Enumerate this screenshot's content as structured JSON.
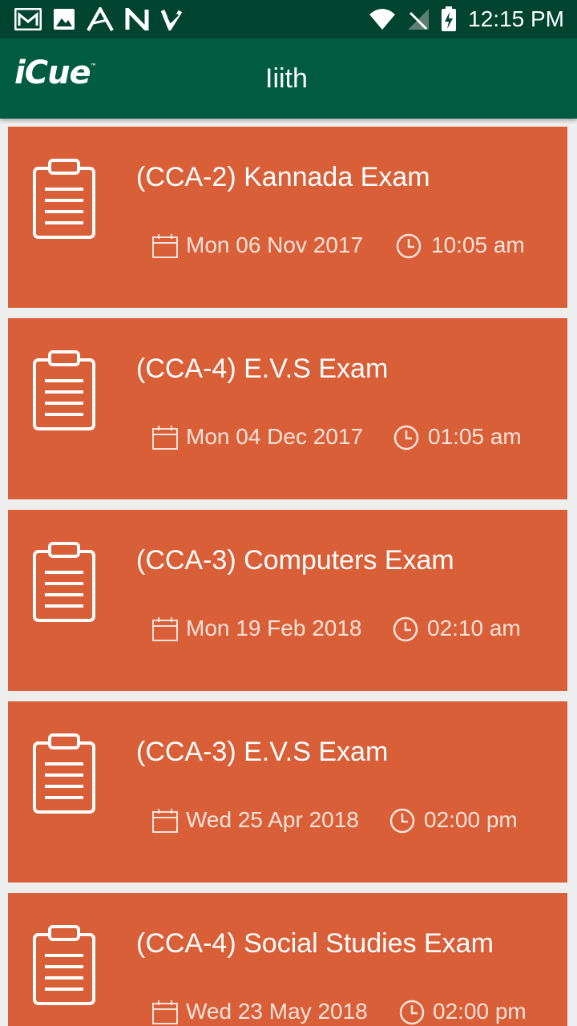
{
  "status_bar": {
    "time": "12:15 PM",
    "left_icons": [
      "gmail-icon",
      "image-icon",
      "app-a-icon",
      "app-n-icon",
      "check-icon"
    ],
    "right_icons": [
      "wifi-icon",
      "no-signal-icon",
      "battery-charging-icon"
    ]
  },
  "app_bar": {
    "logo": "iCue",
    "trademark": "™",
    "title": "Iiith",
    "color": "#005c40"
  },
  "exams": [
    {
      "title": "(CCA-2) Kannada Exam",
      "date": "Mon 06 Nov 2017",
      "time": "10:05 am"
    },
    {
      "title": "(CCA-4) E.V.S Exam",
      "date": "Mon 04 Dec 2017",
      "time": "01:05 am"
    },
    {
      "title": "(CCA-3) Computers Exam",
      "date": "Mon 19 Feb 2018",
      "time": "02:10 am"
    },
    {
      "title": "(CCA-3) E.V.S Exam",
      "date": "Wed 25 Apr 2018",
      "time": "02:00 pm"
    },
    {
      "title": "(CCA-4) Social Studies Exam",
      "date": "Wed 23 May 2018",
      "time": "02:00 pm"
    }
  ],
  "colors": {
    "card": "#d95f38",
    "status_bar": "#00442f",
    "list_background": "#eeeeee"
  }
}
